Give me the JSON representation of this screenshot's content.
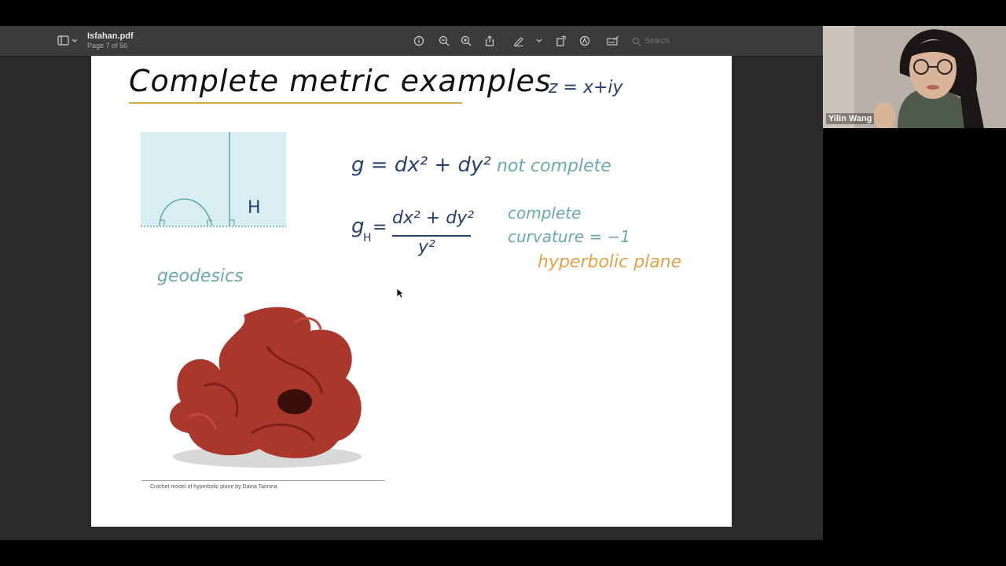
{
  "app": {
    "file_name": "Isfahan.pdf",
    "page_info": "Page 7 of 56",
    "search_placeholder": "Search"
  },
  "slide": {
    "title": "Complete metric examples",
    "z_def": "z = x+iy",
    "euclid_metric": "g = dx² + dy²",
    "euclid_note": "not complete",
    "hyp_lhs": "g",
    "hyp_sub": "H",
    "hyp_num": "dx² + dy²",
    "hyp_den": "y²",
    "hyp_note1": "complete",
    "hyp_note2": "curvature = −1",
    "hyp_note3": "hyperbolic plane",
    "diagram_label": "H",
    "geodesics_label": "geodesics",
    "photo_caption": "Crochet model of hyperbolic plane by Daina Taimina"
  },
  "participant": {
    "name": "Yilin Wang"
  },
  "colors": {
    "dark_blue": "#28406e",
    "teal": "#6aaaa8",
    "orange": "#e3a24a",
    "crochet_red": "#a9372c",
    "halfplane_fill": "#d9eef3"
  }
}
